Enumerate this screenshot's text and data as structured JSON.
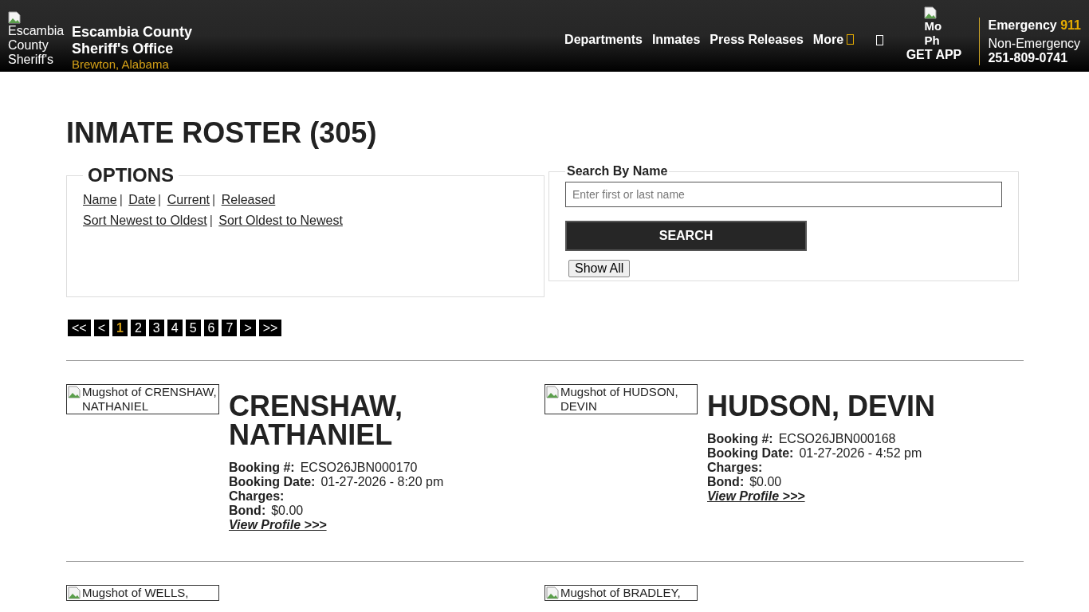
{
  "header": {
    "logo_alt": "Escambia County Sheriff's",
    "site_title": "Escambia County Sheriff's Office",
    "location": "Brewton, Alabama",
    "nav": [
      {
        "label": "Departments",
        "kind": "link"
      },
      {
        "label": "Inmates",
        "kind": "link"
      },
      {
        "label": "Press Releases",
        "kind": "link"
      },
      {
        "label": "More",
        "kind": "dropdown"
      },
      {
        "kind": "icon"
      }
    ],
    "app": {
      "image_alt": "Mo Ph",
      "label": "GET APP"
    },
    "contact": {
      "emergency_label": "Emergency",
      "emergency_number": "911",
      "non_emergency_label": "Non-Emergency",
      "non_emergency_number": "251-809-0741"
    }
  },
  "page_title": "INMATE ROSTER (305)",
  "options": {
    "legend": "OPTIONS",
    "separator": "|",
    "sort_links": [
      "Name",
      "Date",
      "Current",
      "Released"
    ],
    "order_links": [
      "Sort Newest to Oldest",
      "Sort Oldest to Newest"
    ]
  },
  "search": {
    "legend": "Search By Name",
    "placeholder": "Enter first or last name",
    "button": "SEARCH",
    "show_all": "Show All"
  },
  "pagination": [
    {
      "label": "<<",
      "selected": false
    },
    {
      "label": "<",
      "selected": false
    },
    {
      "label": "1",
      "selected": true
    },
    {
      "label": "2",
      "selected": false
    },
    {
      "label": "3",
      "selected": false
    },
    {
      "label": "4",
      "selected": false
    },
    {
      "label": "5",
      "selected": false
    },
    {
      "label": "6",
      "selected": false
    },
    {
      "label": "7",
      "selected": false
    },
    {
      "label": ">",
      "selected": false
    },
    {
      "label": ">>",
      "selected": false
    }
  ],
  "inmates": [
    {
      "name": "CRENSHAW, NATHANIEL",
      "image_alt": "Mugshot of CRENSHAW, NATHANIEL",
      "fields": [
        {
          "label": "Booking #:",
          "value": "ECSO26JBN000170"
        },
        {
          "label": "Booking Date:",
          "value": "01-27-2026 - 8:20 pm"
        },
        {
          "label": "Charges:"
        },
        {
          "label": "Bond:",
          "value": "$0.00"
        }
      ],
      "link": "View Profile >>>"
    },
    {
      "name": "HUDSON, DEVIN",
      "image_alt": "Mugshot of HUDSON, DEVIN",
      "fields": [
        {
          "label": "Booking #:",
          "value": "ECSO26JBN000168"
        },
        {
          "label": "Booking Date:",
          "value": "01-27-2026 - 4:52 pm"
        },
        {
          "label": "Charges:"
        },
        {
          "label": "Bond:",
          "value": "$0.00"
        }
      ],
      "link": "View Profile >>>"
    }
  ],
  "next_row": [
    {
      "image_alt": "Mugshot of WELLS,"
    },
    {
      "image_alt": "Mugshot of BRADLEY,"
    }
  ]
}
